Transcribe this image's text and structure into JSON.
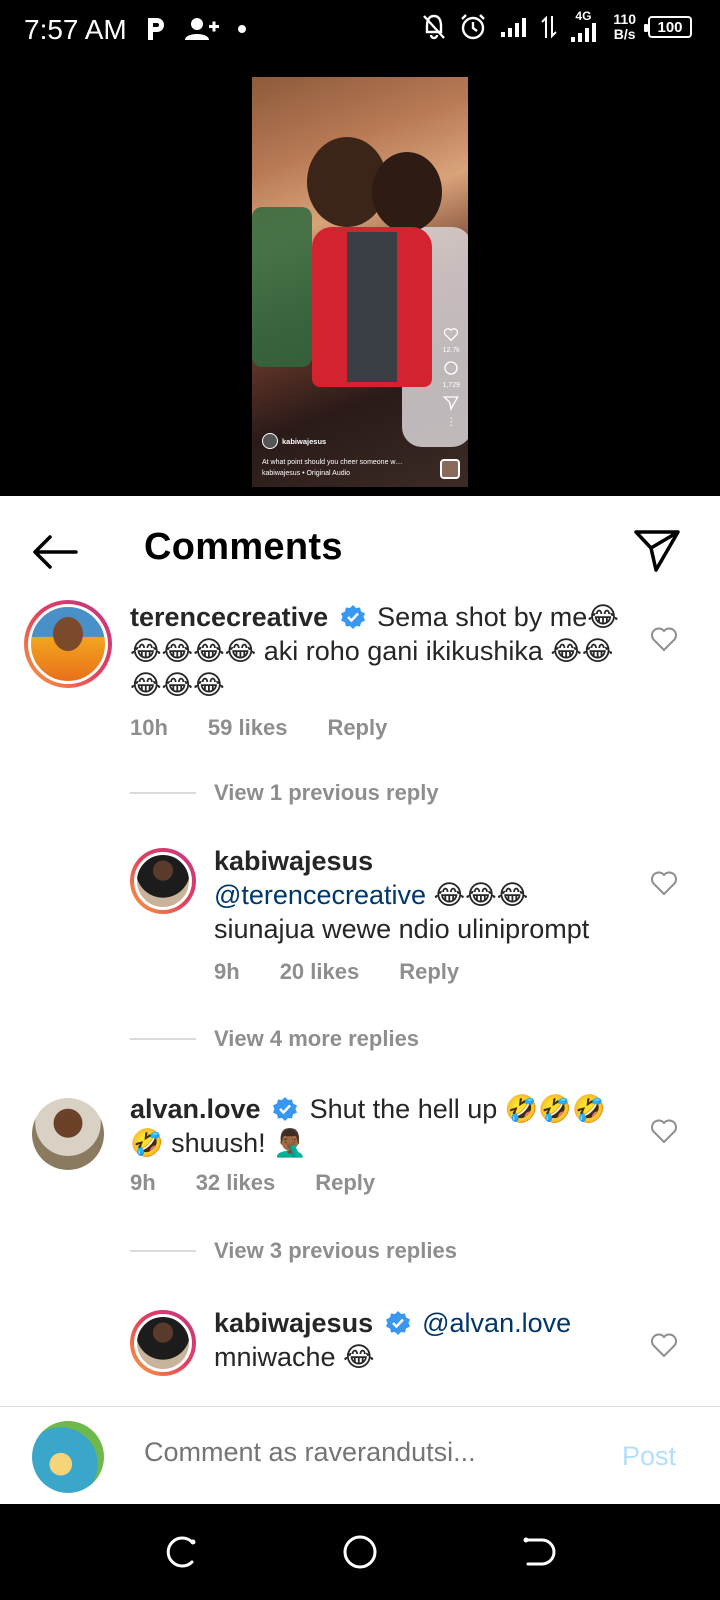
{
  "status_bar": {
    "time": "7:57 AM",
    "network_speed_value": "110",
    "network_speed_unit": "B/s",
    "network_type": "4G",
    "battery": "100"
  },
  "video": {
    "likes": "12.7k",
    "comments": "1,729",
    "username": "kabiwajesus",
    "caption": "At what point should you cheer someone w…",
    "audio": "kabiwajesus • Original Audio"
  },
  "header": {
    "title": "Comments"
  },
  "comments": [
    {
      "username": "terencecreative",
      "text": "Sema shot by me😂😂😂😂😂 aki roho gani ikikushika 😂😂😂😂😂",
      "time": "10h",
      "likes": "59 likes",
      "reply": "Reply"
    },
    {
      "username": "kabiwajesus",
      "mention": "@terencecreative",
      "text": " 😂😂😂 siunajua wewe ndio uliniprompt",
      "time": "9h",
      "likes": "20 likes",
      "reply": "Reply"
    },
    {
      "username": "alvan.love",
      "text": "Shut the hell up 🤣🤣🤣🤣 shuush! 🤦🏾‍♂️",
      "time": "9h",
      "likes": "32 likes",
      "reply": "Reply"
    },
    {
      "username": "kabiwajesus",
      "mention": "@alvan.love",
      "text": " mniwache 😂"
    }
  ],
  "view_replies": {
    "first": "View 1 previous reply",
    "second": "View 4 more replies",
    "third": "View 3 previous replies"
  },
  "comment_bar": {
    "placeholder": "Comment as raverandutsi...",
    "post_label": "Post"
  },
  "colors": {
    "verified_blue": "#3897f0",
    "mention": "#00376b",
    "post_disabled": "#b2dffc",
    "meta_gray": "#8e8e8e"
  }
}
